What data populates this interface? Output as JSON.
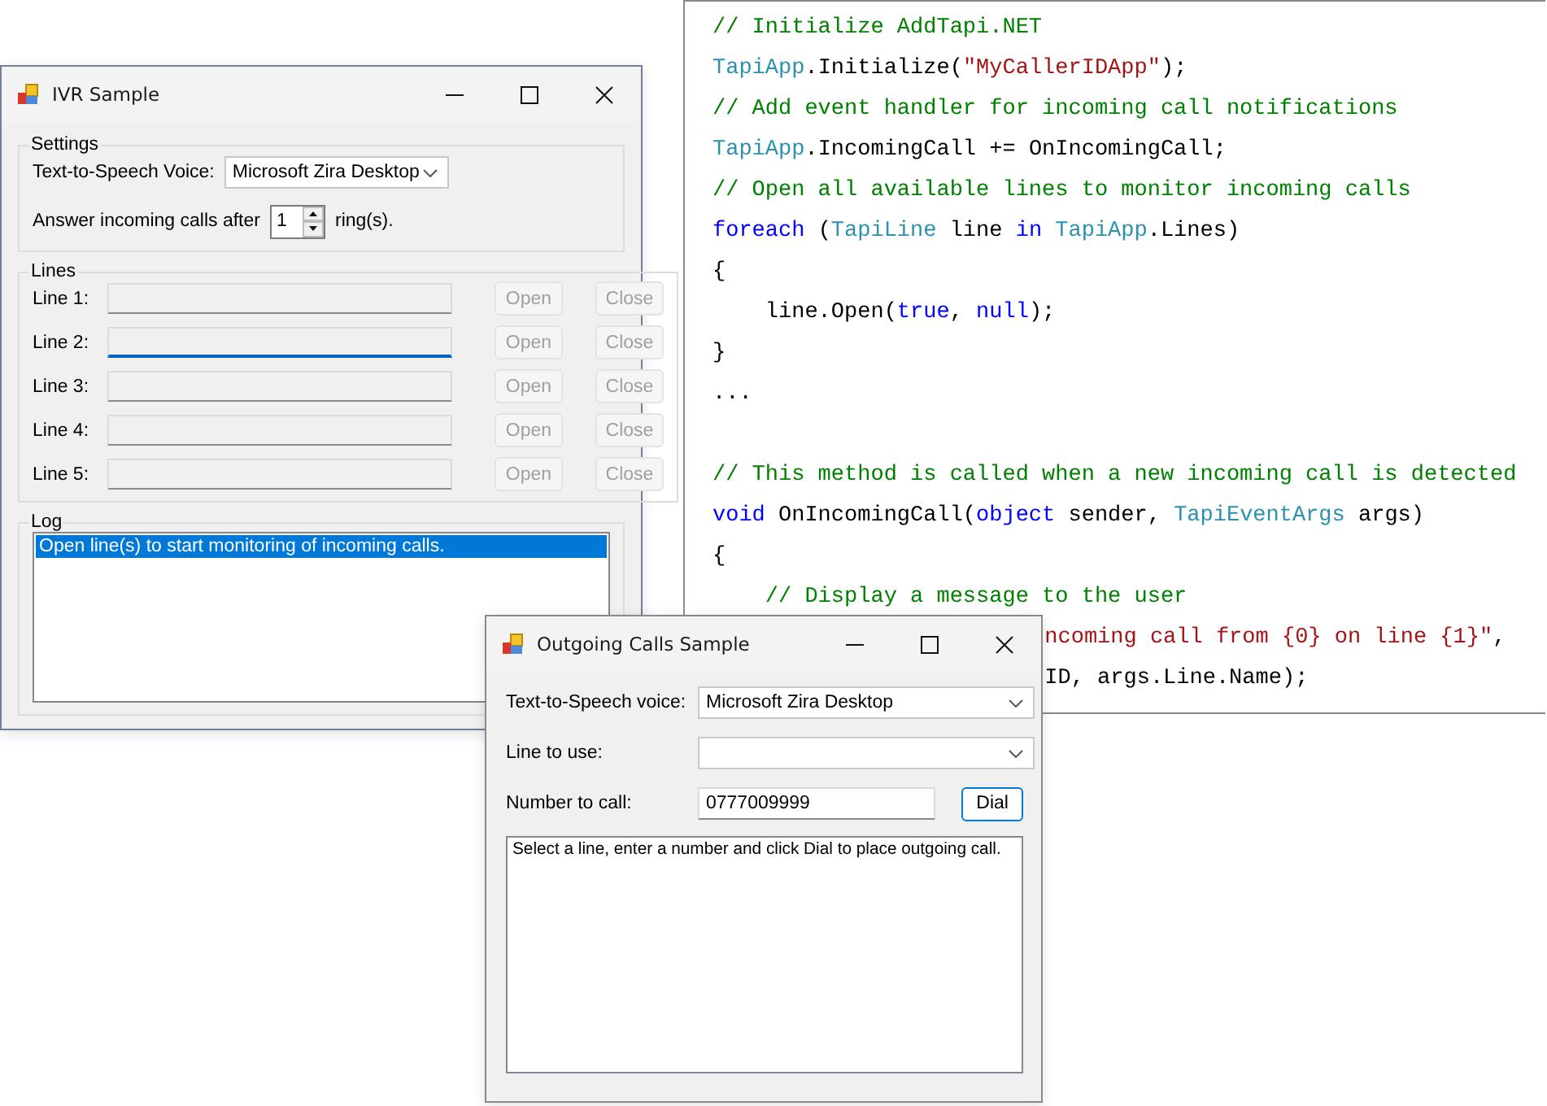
{
  "code_panel": {
    "sections": [
      {
        "lines": [
          {
            "covered": false,
            "tokens": [
              {
                "kind": "comment",
                "text": "// Initialize AddTapi.NET"
              }
            ]
          },
          {
            "covered": false,
            "tokens": [
              {
                "kind": "type",
                "text": "TapiApp"
              },
              {
                "kind": "plain",
                "text": ".Initialize("
              },
              {
                "kind": "string",
                "text": "\"MyCallerIDApp\""
              },
              {
                "kind": "plain",
                "text": ");"
              }
            ]
          },
          {
            "covered": false,
            "tokens": [
              {
                "kind": "comment",
                "text": "// Add event handler for incoming call notifications"
              }
            ]
          },
          {
            "covered": false,
            "tokens": [
              {
                "kind": "type",
                "text": "TapiApp"
              },
              {
                "kind": "plain",
                "text": ".IncomingCall += OnIncomingCall;"
              }
            ]
          },
          {
            "covered": false,
            "tokens": [
              {
                "kind": "comment",
                "text": "// Open all available lines to monitor incoming calls"
              }
            ]
          },
          {
            "covered": false,
            "tokens": [
              {
                "kind": "keyword",
                "text": "foreach"
              },
              {
                "kind": "plain",
                "text": " ("
              },
              {
                "kind": "type",
                "text": "TapiLine"
              },
              {
                "kind": "plain",
                "text": " line "
              },
              {
                "kind": "keyword",
                "text": "in"
              },
              {
                "kind": "type",
                "text": " TapiApp"
              },
              {
                "kind": "plain",
                "text": ".Lines)"
              }
            ]
          },
          {
            "covered": false,
            "tokens": [
              {
                "kind": "plain",
                "text": "{"
              }
            ]
          },
          {
            "covered": false,
            "tokens": [
              {
                "kind": "plain",
                "text": "    line.Open("
              },
              {
                "kind": "keyword",
                "text": "true"
              },
              {
                "kind": "plain",
                "text": ", "
              },
              {
                "kind": "keyword",
                "text": "null"
              },
              {
                "kind": "plain",
                "text": ");"
              }
            ]
          },
          {
            "covered": false,
            "tokens": [
              {
                "kind": "plain",
                "text": "}"
              }
            ]
          },
          {
            "covered": false,
            "tokens": [
              {
                "kind": "plain",
                "text": "..."
              }
            ]
          }
        ]
      },
      {
        "lines": [
          {
            "covered": false,
            "tokens": [
              {
                "kind": "comment",
                "text": "// This method is called when a new incoming call is detected"
              }
            ]
          },
          {
            "covered": false,
            "tokens": [
              {
                "kind": "keyword",
                "text": "void"
              },
              {
                "kind": "plain",
                "text": " OnIncomingCall("
              },
              {
                "kind": "keyword",
                "text": "object"
              },
              {
                "kind": "plain",
                "text": " sender, "
              },
              {
                "kind": "type",
                "text": "TapiEventArgs"
              },
              {
                "kind": "plain",
                "text": " args)"
              }
            ]
          },
          {
            "covered": false,
            "tokens": [
              {
                "kind": "plain",
                "text": "{"
              }
            ]
          },
          {
            "covered": false,
            "tokens": [
              {
                "kind": "comment",
                "text": "    // Display a message to the user"
              }
            ]
          },
          {
            "covered": true,
            "tokens": [
              {
                "kind": "string",
                "text": "ncoming call from {0} on line {1}\""
              },
              {
                "kind": "plain",
                "text": ","
              }
            ]
          },
          {
            "covered": true,
            "tokens": [
              {
                "kind": "plain",
                "text": "ID, args.Line.Name);"
              }
            ]
          }
        ]
      }
    ]
  },
  "ivr_window": {
    "title": "IVR Sample",
    "settings": {
      "legend": "Settings",
      "voice_label": "Text-to-Speech Voice:",
      "voice_value": "Microsoft Zira Desktop",
      "answer_label": "Answer incoming calls after",
      "rings_value": "1",
      "rings_suffix": "ring(s)."
    },
    "lines": {
      "legend": "Lines",
      "rows": [
        {
          "label": "Line 1:",
          "focused": false,
          "open": {
            "label": "Open",
            "disabled": true
          },
          "close": {
            "label": "Close",
            "disabled": true
          }
        },
        {
          "label": "Line 2:",
          "focused": true,
          "open": {
            "label": "Open",
            "disabled": true
          },
          "close": {
            "label": "Close",
            "disabled": true
          }
        },
        {
          "label": "Line 3:",
          "focused": false,
          "open": {
            "label": "Open",
            "disabled": true
          },
          "close": {
            "label": "Close",
            "disabled": true
          }
        },
        {
          "label": "Line 4:",
          "focused": false,
          "open": {
            "label": "Open",
            "disabled": true
          },
          "close": {
            "label": "Close",
            "disabled": true
          }
        },
        {
          "label": "Line 5:",
          "focused": false,
          "open": {
            "label": "Open",
            "disabled": true
          },
          "close": {
            "label": "Close",
            "disabled": true
          }
        }
      ]
    },
    "log": {
      "legend": "Log",
      "items": [
        {
          "text": "Open line(s) to start monitoring of incoming calls.",
          "selected": true
        }
      ]
    }
  },
  "outgoing_window": {
    "title": "Outgoing Calls Sample",
    "voice_label": "Text-to-Speech voice:",
    "voice_value": "Microsoft Zira Desktop",
    "line_label": "Line to use:",
    "number_label": "Number to call:",
    "number_value": "0777009999",
    "dial_button": "Dial",
    "log_text": "Select a line, enter a number and click Dial to place outgoing call."
  }
}
